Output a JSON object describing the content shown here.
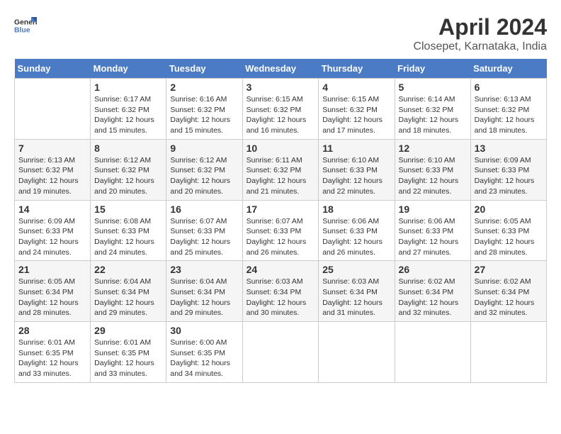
{
  "header": {
    "logo_line1": "General",
    "logo_line2": "Blue",
    "title": "April 2024",
    "subtitle": "Closepet, Karnataka, India"
  },
  "days_of_week": [
    "Sunday",
    "Monday",
    "Tuesday",
    "Wednesday",
    "Thursday",
    "Friday",
    "Saturday"
  ],
  "weeks": [
    [
      {
        "day": "",
        "sunrise": "",
        "sunset": "",
        "daylight": ""
      },
      {
        "day": "1",
        "sunrise": "6:17 AM",
        "sunset": "6:32 PM",
        "daylight": "12 hours and 15 minutes."
      },
      {
        "day": "2",
        "sunrise": "6:16 AM",
        "sunset": "6:32 PM",
        "daylight": "12 hours and 15 minutes."
      },
      {
        "day": "3",
        "sunrise": "6:15 AM",
        "sunset": "6:32 PM",
        "daylight": "12 hours and 16 minutes."
      },
      {
        "day": "4",
        "sunrise": "6:15 AM",
        "sunset": "6:32 PM",
        "daylight": "12 hours and 17 minutes."
      },
      {
        "day": "5",
        "sunrise": "6:14 AM",
        "sunset": "6:32 PM",
        "daylight": "12 hours and 18 minutes."
      },
      {
        "day": "6",
        "sunrise": "6:13 AM",
        "sunset": "6:32 PM",
        "daylight": "12 hours and 18 minutes."
      }
    ],
    [
      {
        "day": "7",
        "sunrise": "6:13 AM",
        "sunset": "6:32 PM",
        "daylight": "12 hours and 19 minutes."
      },
      {
        "day": "8",
        "sunrise": "6:12 AM",
        "sunset": "6:32 PM",
        "daylight": "12 hours and 20 minutes."
      },
      {
        "day": "9",
        "sunrise": "6:12 AM",
        "sunset": "6:32 PM",
        "daylight": "12 hours and 20 minutes."
      },
      {
        "day": "10",
        "sunrise": "6:11 AM",
        "sunset": "6:32 PM",
        "daylight": "12 hours and 21 minutes."
      },
      {
        "day": "11",
        "sunrise": "6:10 AM",
        "sunset": "6:33 PM",
        "daylight": "12 hours and 22 minutes."
      },
      {
        "day": "12",
        "sunrise": "6:10 AM",
        "sunset": "6:33 PM",
        "daylight": "12 hours and 22 minutes."
      },
      {
        "day": "13",
        "sunrise": "6:09 AM",
        "sunset": "6:33 PM",
        "daylight": "12 hours and 23 minutes."
      }
    ],
    [
      {
        "day": "14",
        "sunrise": "6:09 AM",
        "sunset": "6:33 PM",
        "daylight": "12 hours and 24 minutes."
      },
      {
        "day": "15",
        "sunrise": "6:08 AM",
        "sunset": "6:33 PM",
        "daylight": "12 hours and 24 minutes."
      },
      {
        "day": "16",
        "sunrise": "6:07 AM",
        "sunset": "6:33 PM",
        "daylight": "12 hours and 25 minutes."
      },
      {
        "day": "17",
        "sunrise": "6:07 AM",
        "sunset": "6:33 PM",
        "daylight": "12 hours and 26 minutes."
      },
      {
        "day": "18",
        "sunrise": "6:06 AM",
        "sunset": "6:33 PM",
        "daylight": "12 hours and 26 minutes."
      },
      {
        "day": "19",
        "sunrise": "6:06 AM",
        "sunset": "6:33 PM",
        "daylight": "12 hours and 27 minutes."
      },
      {
        "day": "20",
        "sunrise": "6:05 AM",
        "sunset": "6:33 PM",
        "daylight": "12 hours and 28 minutes."
      }
    ],
    [
      {
        "day": "21",
        "sunrise": "6:05 AM",
        "sunset": "6:34 PM",
        "daylight": "12 hours and 28 minutes."
      },
      {
        "day": "22",
        "sunrise": "6:04 AM",
        "sunset": "6:34 PM",
        "daylight": "12 hours and 29 minutes."
      },
      {
        "day": "23",
        "sunrise": "6:04 AM",
        "sunset": "6:34 PM",
        "daylight": "12 hours and 29 minutes."
      },
      {
        "day": "24",
        "sunrise": "6:03 AM",
        "sunset": "6:34 PM",
        "daylight": "12 hours and 30 minutes."
      },
      {
        "day": "25",
        "sunrise": "6:03 AM",
        "sunset": "6:34 PM",
        "daylight": "12 hours and 31 minutes."
      },
      {
        "day": "26",
        "sunrise": "6:02 AM",
        "sunset": "6:34 PM",
        "daylight": "12 hours and 32 minutes."
      },
      {
        "day": "27",
        "sunrise": "6:02 AM",
        "sunset": "6:34 PM",
        "daylight": "12 hours and 32 minutes."
      }
    ],
    [
      {
        "day": "28",
        "sunrise": "6:01 AM",
        "sunset": "6:35 PM",
        "daylight": "12 hours and 33 minutes."
      },
      {
        "day": "29",
        "sunrise": "6:01 AM",
        "sunset": "6:35 PM",
        "daylight": "12 hours and 33 minutes."
      },
      {
        "day": "30",
        "sunrise": "6:00 AM",
        "sunset": "6:35 PM",
        "daylight": "12 hours and 34 minutes."
      },
      {
        "day": "",
        "sunrise": "",
        "sunset": "",
        "daylight": ""
      },
      {
        "day": "",
        "sunrise": "",
        "sunset": "",
        "daylight": ""
      },
      {
        "day": "",
        "sunrise": "",
        "sunset": "",
        "daylight": ""
      },
      {
        "day": "",
        "sunrise": "",
        "sunset": "",
        "daylight": ""
      }
    ]
  ],
  "labels": {
    "sunrise_prefix": "Sunrise: ",
    "sunset_prefix": "Sunset: ",
    "daylight_prefix": "Daylight: "
  }
}
